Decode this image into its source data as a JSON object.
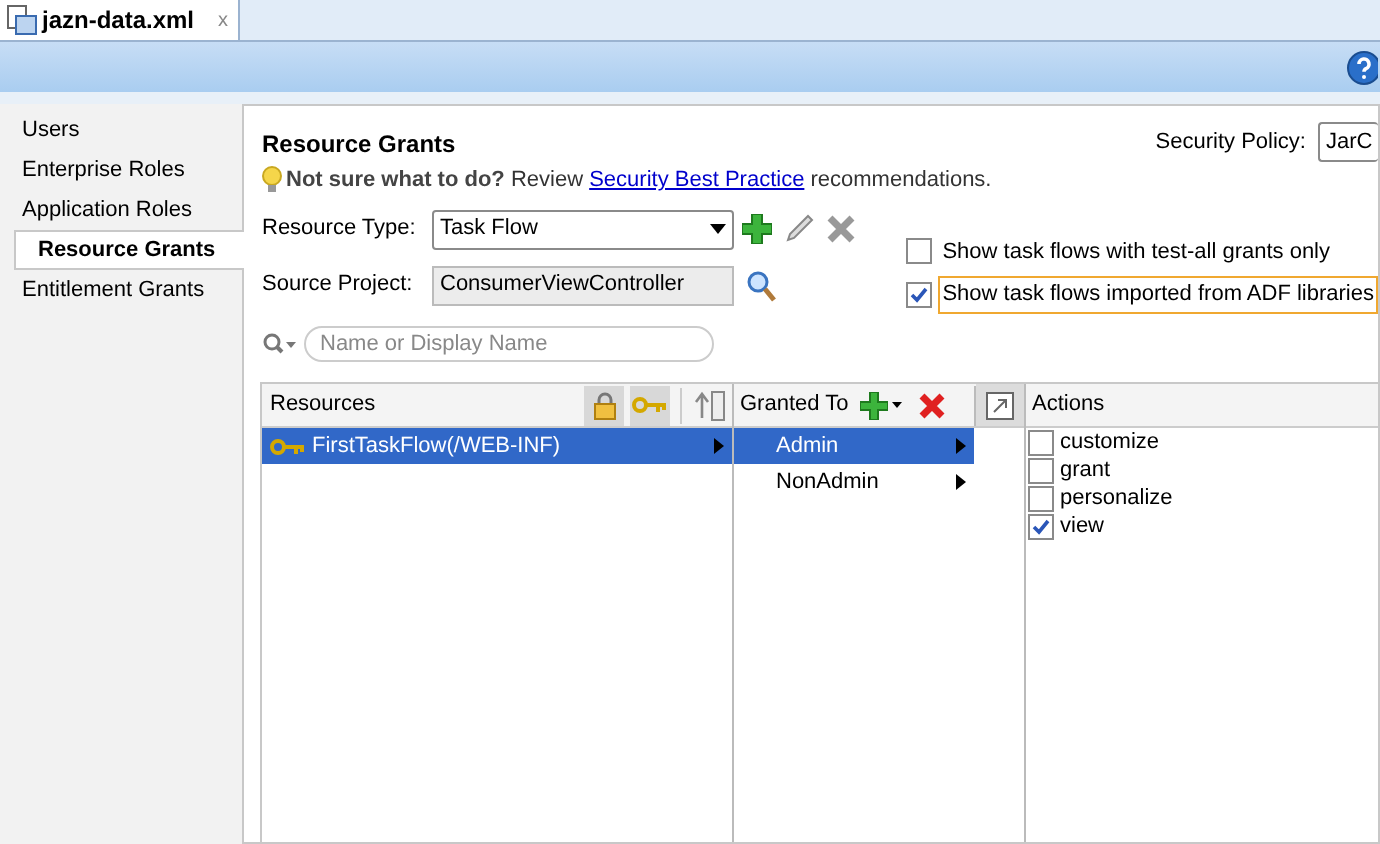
{
  "editor_tab": {
    "title": "jazn-data.xml",
    "close": "x"
  },
  "sidebar": {
    "items": [
      {
        "label": "Users",
        "selected": false
      },
      {
        "label": "Enterprise Roles",
        "selected": false
      },
      {
        "label": "Application Roles",
        "selected": false
      },
      {
        "label": "Resource Grants",
        "selected": true
      },
      {
        "label": "Entitlement Grants",
        "selected": false
      }
    ]
  },
  "panel": {
    "title": "Resource Grants",
    "security_policy": {
      "label": "Security Policy:",
      "value": "JarC"
    },
    "hint": {
      "bold": "Not sure what to do?",
      "before": "Review",
      "link": "Security Best Practice",
      "after": "recommendations."
    },
    "resource_type": {
      "label": "Resource Type:",
      "value": "Task Flow"
    },
    "source_project": {
      "label": "Source Project:",
      "value": "ConsumerViewController"
    },
    "options": [
      {
        "label": "Show task flows with test-all grants only",
        "checked": false,
        "focused": false
      },
      {
        "label": "Show task flows imported from ADF libraries",
        "checked": true,
        "focused": true
      }
    ],
    "search": {
      "placeholder": "Name or Display Name"
    },
    "resources": {
      "header": "Resources",
      "rows": [
        {
          "label": "FirstTaskFlow(/WEB-INF)",
          "selected": true
        }
      ]
    },
    "granted_to": {
      "header": "Granted To",
      "rows": [
        {
          "label": "Admin",
          "selected": true
        },
        {
          "label": "NonAdmin",
          "selected": false
        }
      ]
    },
    "actions": {
      "header": "Actions",
      "rows": [
        {
          "label": "customize",
          "checked": false
        },
        {
          "label": "grant",
          "checked": false
        },
        {
          "label": "personalize",
          "checked": false
        },
        {
          "label": "view",
          "checked": true
        }
      ]
    }
  }
}
